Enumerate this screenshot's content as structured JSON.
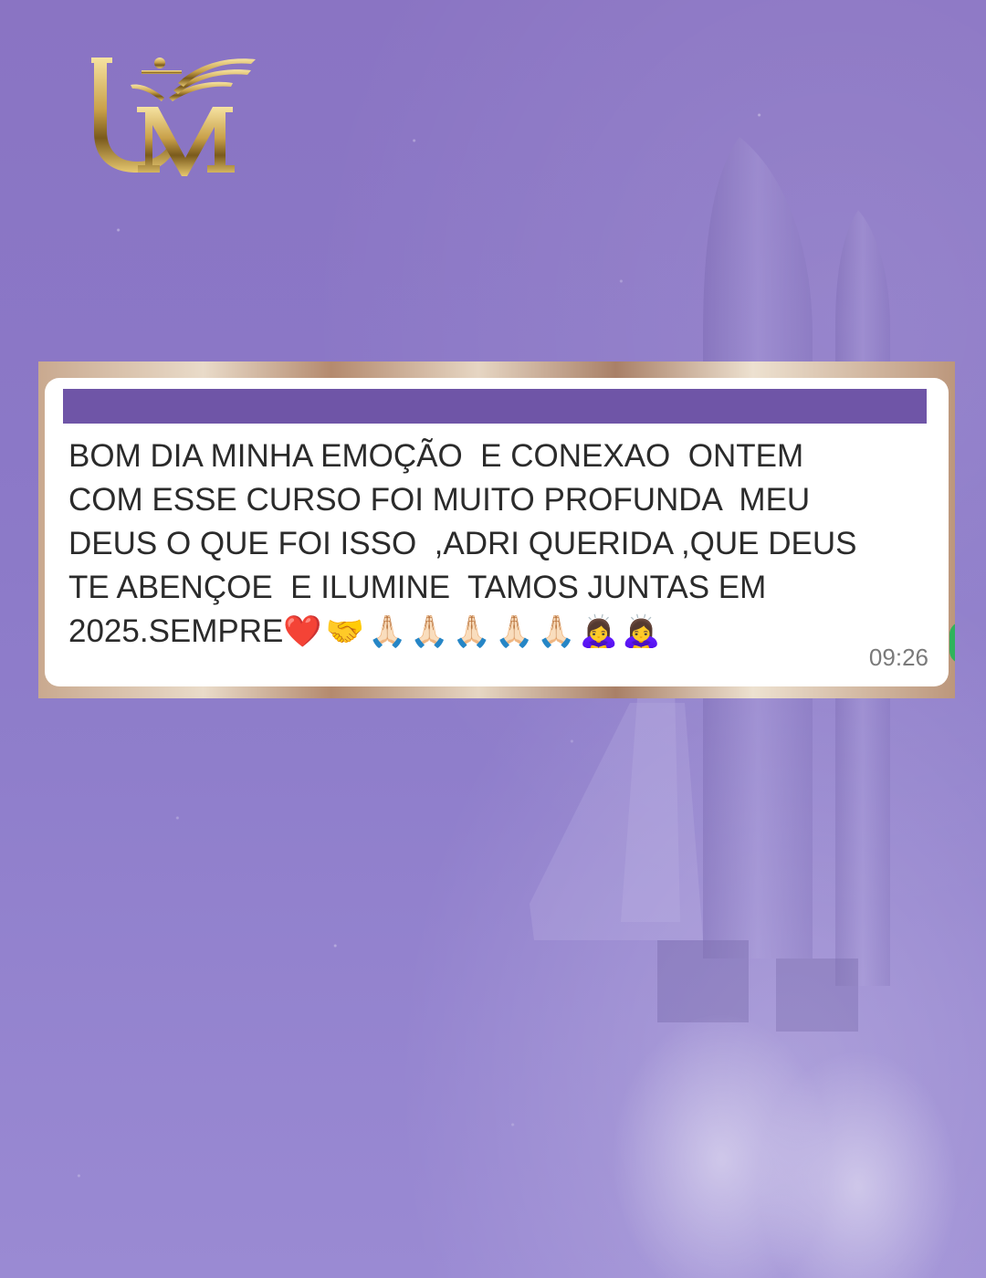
{
  "brand": {
    "logo_text": "UM",
    "colors": {
      "gold": "#c9a14a",
      "purple": "#6f55a7",
      "background": "#8b78c7"
    }
  },
  "message": {
    "text": "BOM DIA MINHA EMOÇÃO  E CONEXAO  ONTEM\nCOM ESSE CURSO FOI MUITO PROFUNDA  MEU\nDEUS O QUE FOI ISSO  ,ADRI QUERIDA ,QUE DEUS\nTE ABENÇOE  E ILUMINE  TAMOS JUNTAS EM\n2025.SEMPRE",
    "emojis": "❤️🤝🙏🏻🙏🏻🙏🏻🙏🏻🙏🏻🙇‍♀️🙇‍♀️",
    "time": "09:26"
  }
}
